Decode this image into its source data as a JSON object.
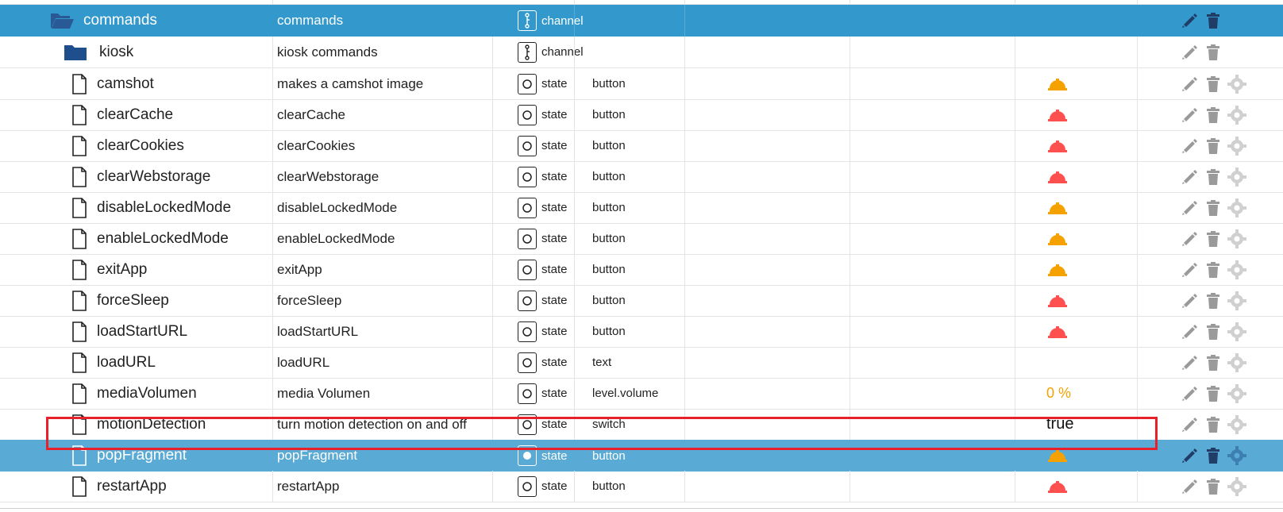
{
  "rows": [
    {
      "name": "commands",
      "desc": "commands",
      "type": "channel",
      "role": "",
      "value": ""
    },
    {
      "name": "kiosk",
      "desc": "kiosk commands",
      "type": "channel",
      "role": "",
      "value": ""
    },
    {
      "name": "camshot",
      "desc": "makes a camshot image",
      "type": "state",
      "role": "button",
      "value": ""
    },
    {
      "name": "clearCache",
      "desc": "clearCache",
      "type": "state",
      "role": "button",
      "value": ""
    },
    {
      "name": "clearCookies",
      "desc": "clearCookies",
      "type": "state",
      "role": "button",
      "value": ""
    },
    {
      "name": "clearWebstorage",
      "desc": "clearWebstorage",
      "type": "state",
      "role": "button",
      "value": ""
    },
    {
      "name": "disableLockedMode",
      "desc": "disableLockedMode",
      "type": "state",
      "role": "button",
      "value": ""
    },
    {
      "name": "enableLockedMode",
      "desc": "enableLockedMode",
      "type": "state",
      "role": "button",
      "value": ""
    },
    {
      "name": "exitApp",
      "desc": "exitApp",
      "type": "state",
      "role": "button",
      "value": ""
    },
    {
      "name": "forceSleep",
      "desc": "forceSleep",
      "type": "state",
      "role": "button",
      "value": ""
    },
    {
      "name": "loadStartURL",
      "desc": "loadStartURL",
      "type": "state",
      "role": "button",
      "value": ""
    },
    {
      "name": "loadURL",
      "desc": "loadURL",
      "type": "state",
      "role": "text",
      "value": ""
    },
    {
      "name": "mediaVolumen",
      "desc": "media Volumen",
      "type": "state",
      "role": "level.volume",
      "value": "0 %"
    },
    {
      "name": "motionDetection",
      "desc": "turn motion detection on and off",
      "type": "state",
      "role": "switch",
      "value": "true"
    },
    {
      "name": "popFragment",
      "desc": "popFragment",
      "type": "state",
      "role": "button",
      "value": ""
    },
    {
      "name": "restartApp",
      "desc": "restartApp",
      "type": "state",
      "role": "button",
      "value": ""
    }
  ],
  "colors": {
    "channel_row_bg": "#3399cc",
    "selected_row_bg": "#5aaad6",
    "bell_orange": "#f5a200",
    "bell_red": "#ff5050",
    "highlight_border": "#e8202a",
    "folder_dark": "#1e4e8c"
  },
  "icons": {
    "folder_open": "folder-open-icon",
    "folder": "folder-icon",
    "file": "file-icon",
    "channel": "channel-type-icon",
    "state": "state-type-icon",
    "bell": "bell-icon",
    "edit": "pencil-icon",
    "delete": "trash-icon",
    "settings": "gear-icon"
  }
}
